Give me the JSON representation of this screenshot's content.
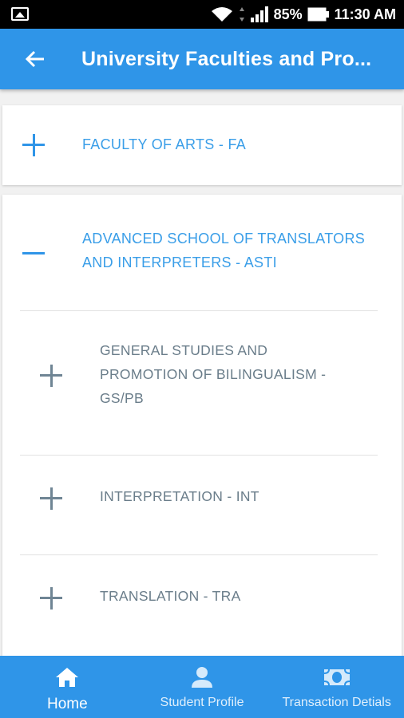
{
  "status_bar": {
    "battery": "85%",
    "time": "11:30 AM"
  },
  "app_bar": {
    "title": "University Faculties and Pro..."
  },
  "faculties": [
    {
      "label": "FACULTY OF ARTS - FA",
      "expanded": false
    },
    {
      "label_line1": "ADVANCED SCHOOL OF TRANSLATORS",
      "label_line2": "AND INTERPRETERS - ASTI",
      "expanded": true,
      "departments": [
        {
          "line1": "GENERAL STUDIES AND",
          "line2": "PROMOTION OF BILINGUALISM -",
          "line3": "GS/PB"
        },
        {
          "line1": "INTERPRETATION - INT"
        },
        {
          "line1": "TRANSLATION - TRA"
        }
      ]
    }
  ],
  "bottom_nav": {
    "home": "Home",
    "profile": "Student Profile",
    "transactions": "Transaction Detials"
  },
  "colors": {
    "primary": "#2f95e8",
    "status_bar": "#000000",
    "department_text": "#6a7d8a"
  }
}
